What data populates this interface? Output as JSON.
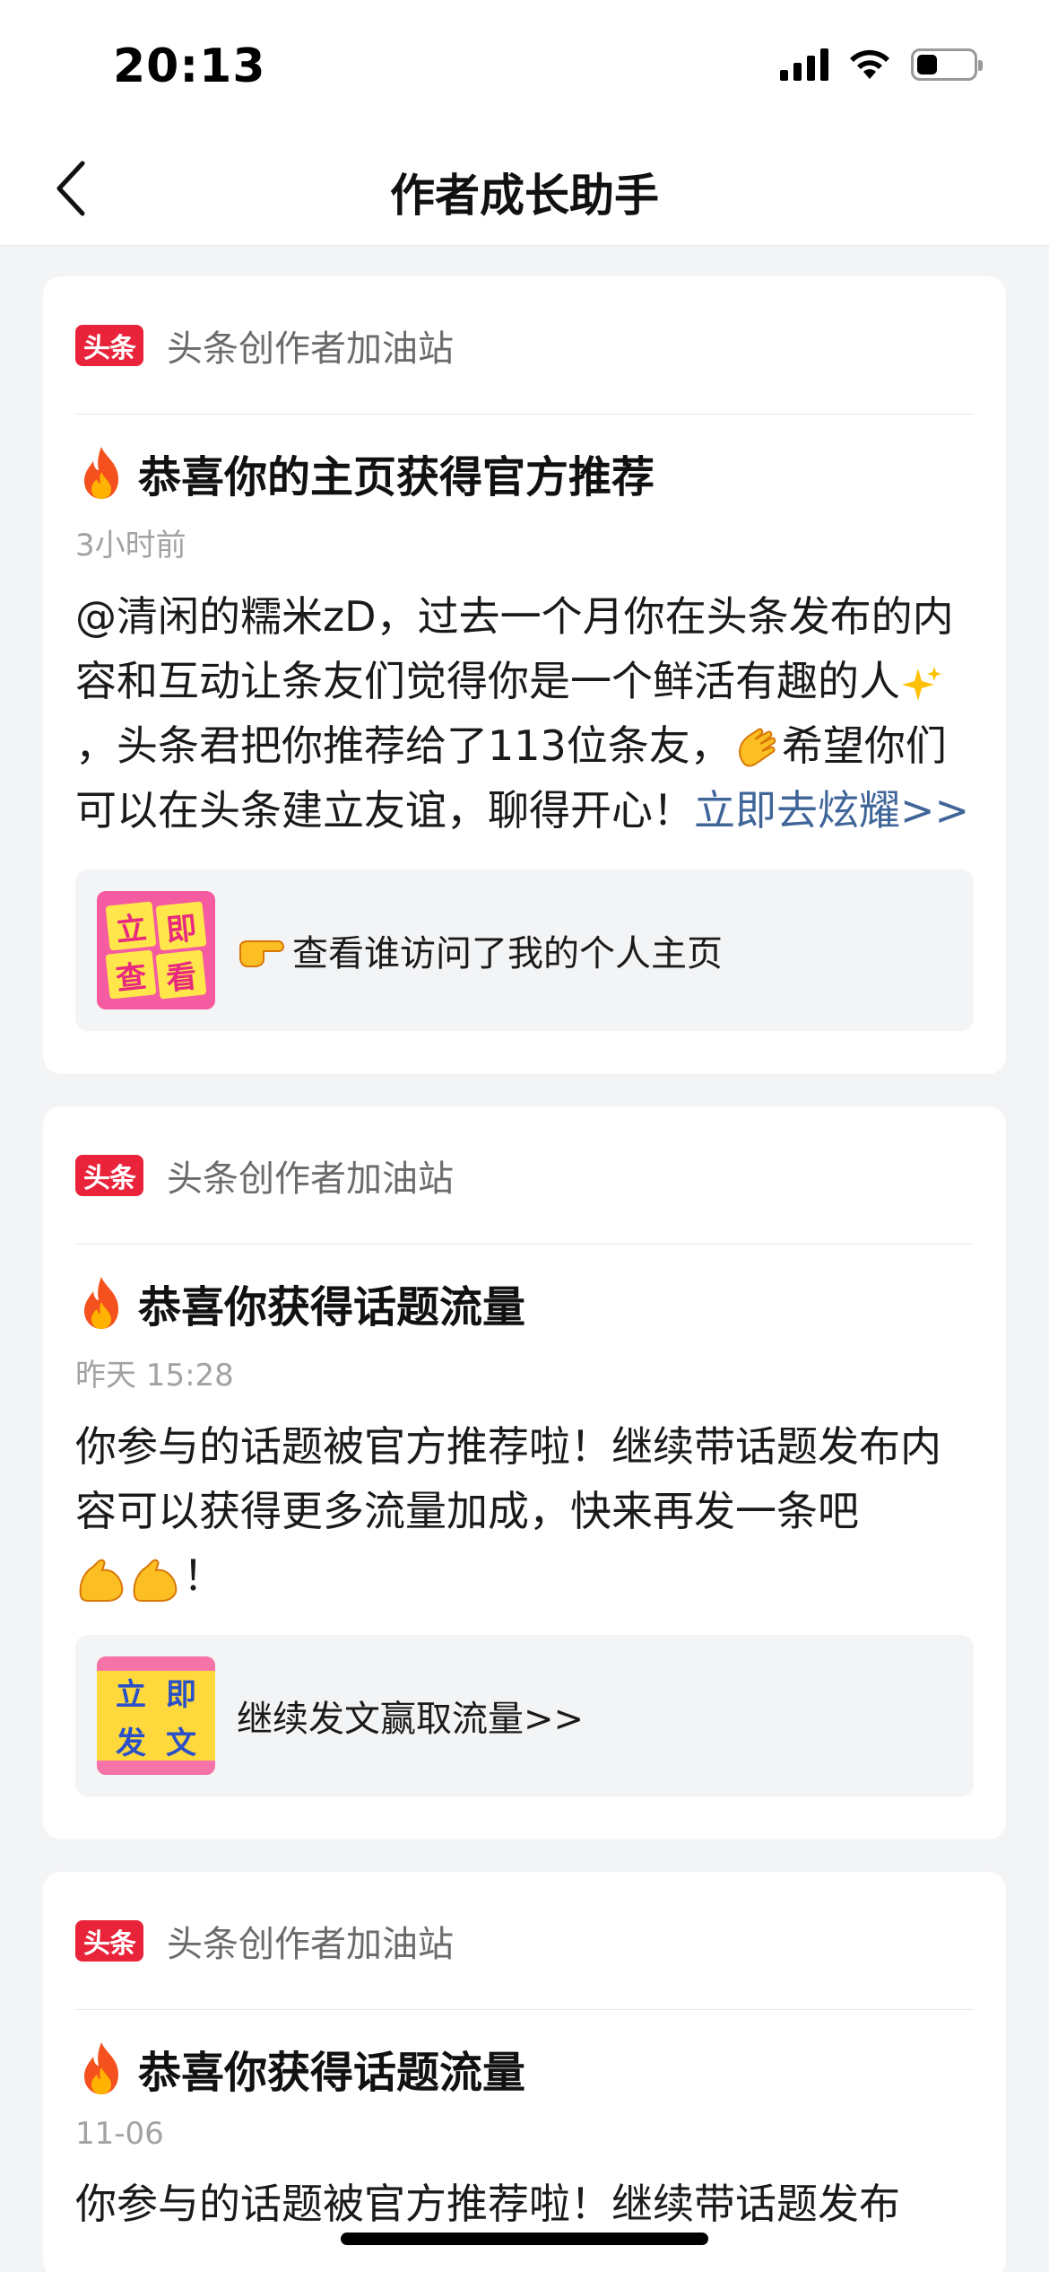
{
  "status_bar": {
    "time": "20:13",
    "signal_icon": "cellular-signal-icon",
    "wifi_icon": "wifi-icon",
    "battery_level": 0.35
  },
  "nav": {
    "back_icon": "chevron-left-icon",
    "title": "作者成长助手"
  },
  "colors": {
    "brand_red": "#e8233a",
    "link_blue": "#406599",
    "background": "#f3f4f6"
  },
  "cards": [
    {
      "logo": "头条",
      "source": "头条创作者加油站",
      "title": "恭喜你的主页获得官方推荐",
      "time": "3小时前",
      "body_part1": "@清闲的糯米zD，过去一个月你在头条发布的内容和互动让条友们觉得你是一个鲜活有趣的人",
      "body_part2": "，头条君把你推荐给了113位条友，",
      "body_part3": "希望你们可以在头条建立友谊，聊得开心！",
      "link": "立即去炫耀>>",
      "thumb_text": [
        "立",
        "即",
        "查",
        "看"
      ],
      "action_text": "查看谁访问了我的个人主页"
    },
    {
      "logo": "头条",
      "source": "头条创作者加油站",
      "title": "恭喜你获得话题流量",
      "time": "昨天 15:28",
      "body_part1": "你参与的话题被官方推荐啦！继续带话题发布内容可以获得更多流量加成，快来再发一条吧",
      "body_part2": "！",
      "thumb_text": [
        "立",
        "即",
        "发",
        "文"
      ],
      "action_text": "继续发文赢取流量>>"
    },
    {
      "logo": "头条",
      "source": "头条创作者加油站",
      "title": "恭喜你获得话题流量",
      "time": "11-06",
      "body_part1": "你参与的话题被官方推荐啦！继续带话题发布"
    }
  ]
}
